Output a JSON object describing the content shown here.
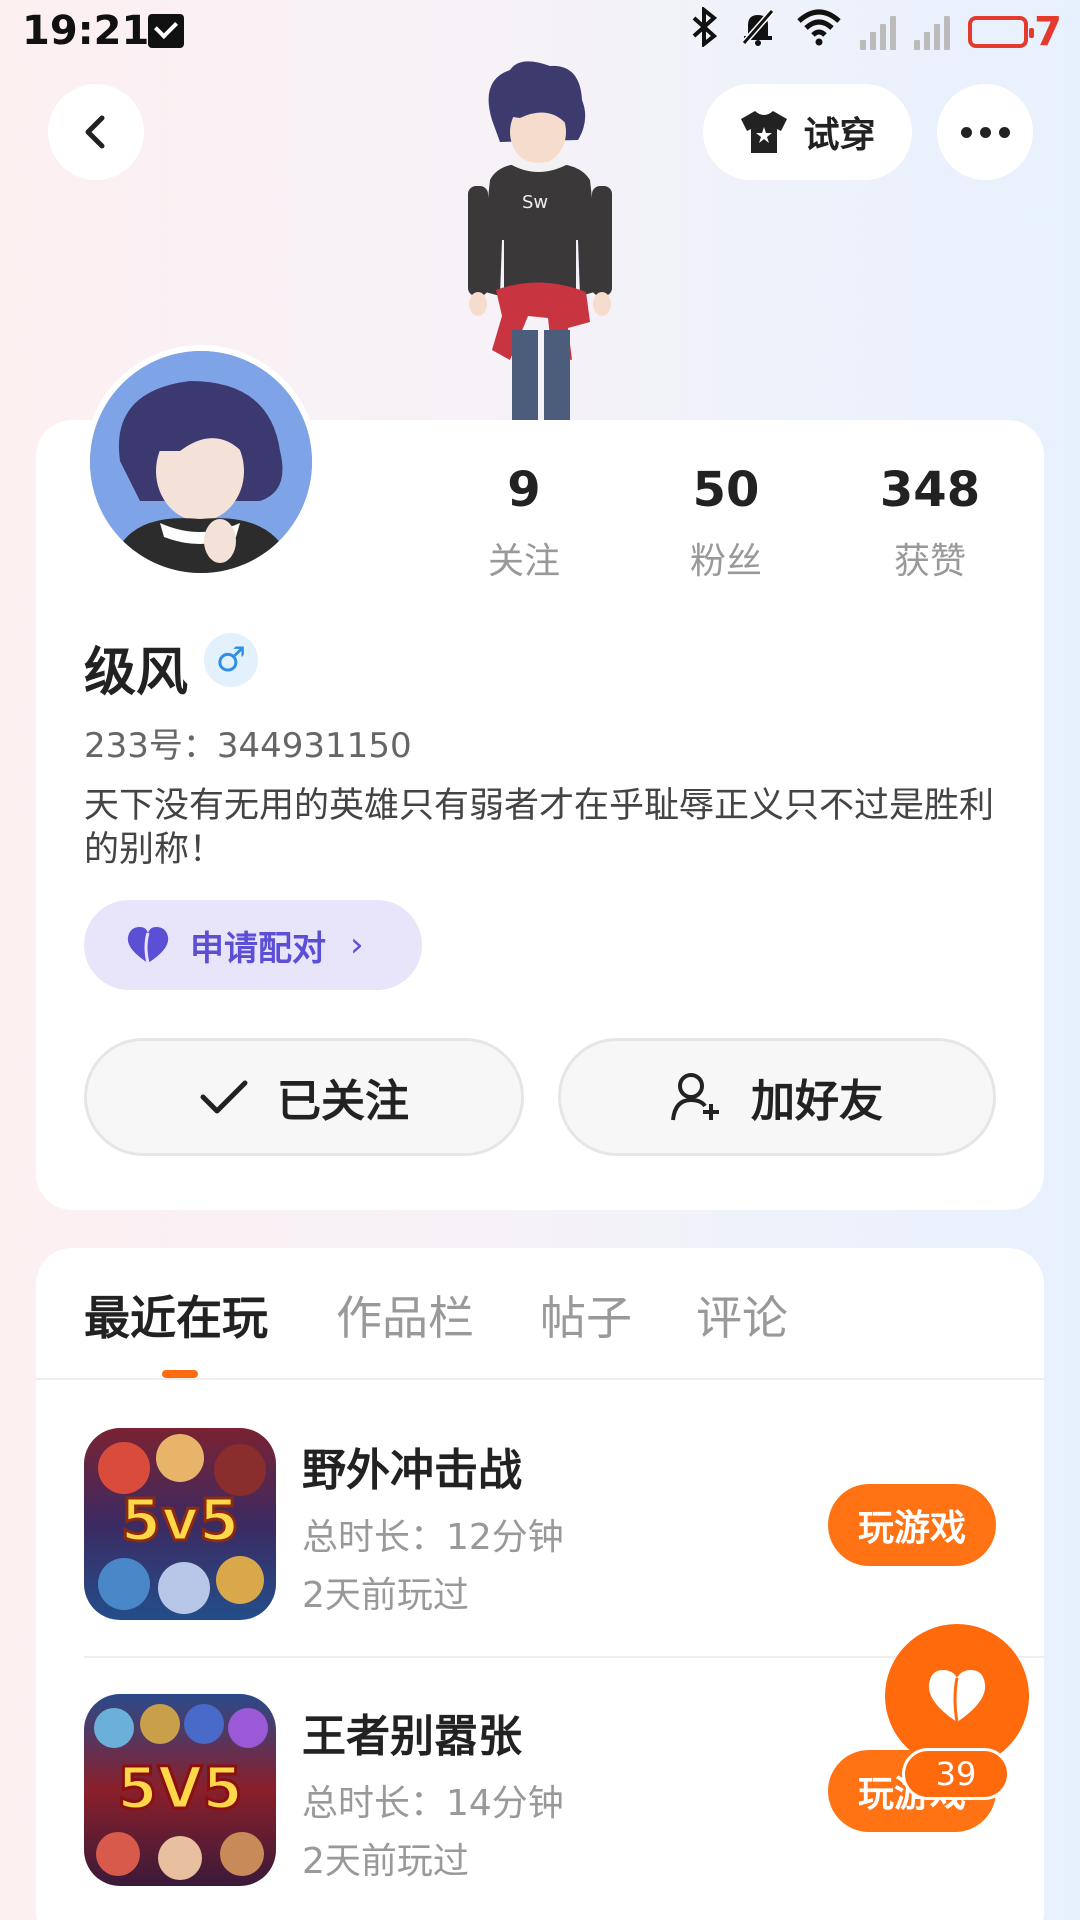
{
  "status_bar": {
    "time": "19:21",
    "battery_level": "7"
  },
  "header": {
    "try_on_label": "试穿"
  },
  "profile": {
    "stats": [
      {
        "value": "9",
        "label": "关注"
      },
      {
        "value": "50",
        "label": "粉丝"
      },
      {
        "value": "348",
        "label": "获赞"
      }
    ],
    "name": "级风",
    "gender_symbol": "♂",
    "account_id": "233号：344931150",
    "bio": "天下没有无用的英雄只有弱者才在乎耻辱正义只不过是胜利的别称！",
    "pair_label": "申请配对",
    "followed_label": "已关注",
    "add_friend_label": "加好友"
  },
  "tabs": [
    "最近在玩",
    "作品栏",
    "帖子",
    "评论"
  ],
  "games": [
    {
      "name": "野外冲击战",
      "duration": "总时长：12分钟",
      "last_played": "2天前玩过",
      "button": "玩游戏",
      "icon_text": "5v5"
    },
    {
      "name": "王者别嚣张",
      "duration": "总时长：14分钟",
      "last_played": "2天前玩过",
      "button": "玩游戏",
      "icon_text": "5V5"
    }
  ],
  "fab": {
    "count": "39"
  },
  "colors": {
    "accent": "#ff6a0d",
    "pair": "#5b4fd6",
    "gender": "#2f8ee6",
    "battery": "#e4392d"
  }
}
